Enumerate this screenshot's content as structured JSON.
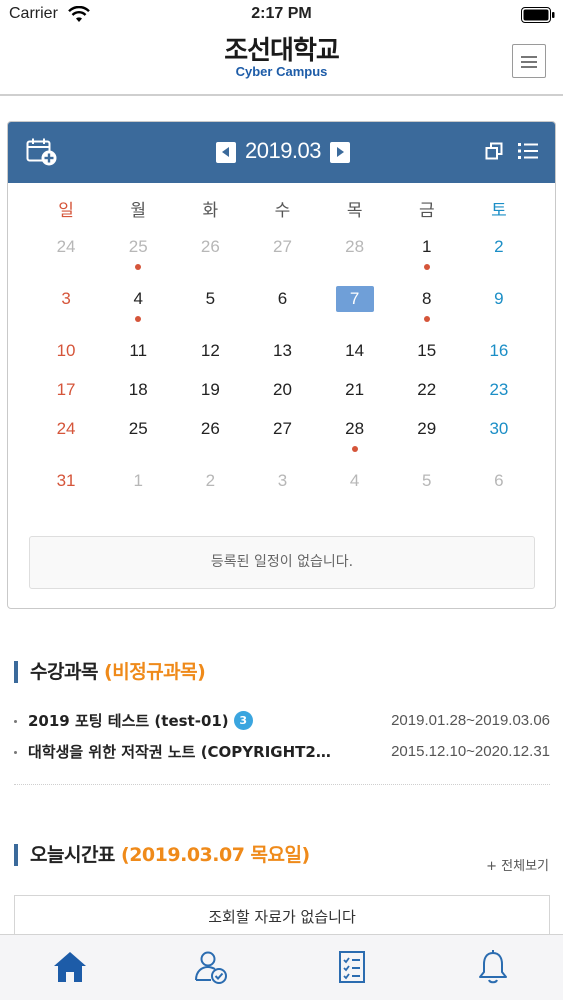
{
  "status_bar": {
    "carrier": "Carrier",
    "time": "2:17 PM"
  },
  "header": {
    "title": "조선대학교",
    "subtitle": "Cyber Campus",
    "menu_icon": "hamburger-menu-icon"
  },
  "calendar": {
    "month_label": "2019.03",
    "weekdays": [
      "일",
      "월",
      "화",
      "수",
      "목",
      "금",
      "토"
    ],
    "weeks": [
      [
        {
          "d": "24",
          "muted": true
        },
        {
          "d": "25",
          "muted": true,
          "dot": true
        },
        {
          "d": "26",
          "muted": true
        },
        {
          "d": "27",
          "muted": true
        },
        {
          "d": "28",
          "muted": true
        },
        {
          "d": "1",
          "dot": true
        },
        {
          "d": "2"
        }
      ],
      [
        {
          "d": "3"
        },
        {
          "d": "4",
          "dot": true
        },
        {
          "d": "5"
        },
        {
          "d": "6"
        },
        {
          "d": "7",
          "today": true
        },
        {
          "d": "8",
          "dot": true
        },
        {
          "d": "9"
        }
      ],
      [
        {
          "d": "10"
        },
        {
          "d": "11"
        },
        {
          "d": "12"
        },
        {
          "d": "13"
        },
        {
          "d": "14"
        },
        {
          "d": "15"
        },
        {
          "d": "16"
        }
      ],
      [
        {
          "d": "17"
        },
        {
          "d": "18"
        },
        {
          "d": "19"
        },
        {
          "d": "20"
        },
        {
          "d": "21"
        },
        {
          "d": "22"
        },
        {
          "d": "23"
        }
      ],
      [
        {
          "d": "24"
        },
        {
          "d": "25"
        },
        {
          "d": "26"
        },
        {
          "d": "27"
        },
        {
          "d": "28",
          "dot": true
        },
        {
          "d": "29"
        },
        {
          "d": "30"
        }
      ],
      [
        {
          "d": "31"
        },
        {
          "d": "1",
          "muted": true
        },
        {
          "d": "2",
          "muted": true
        },
        {
          "d": "3",
          "muted": true
        },
        {
          "d": "4",
          "muted": true
        },
        {
          "d": "5",
          "muted": true
        },
        {
          "d": "6",
          "muted": true
        }
      ]
    ],
    "no_events_text": "등록된 일정이 없습니다.",
    "colors": {
      "header_bg": "#3b6a9b",
      "sunday": "#d5553a",
      "saturday": "#1b8ec6",
      "today_bg": "#6f9fd8",
      "event_dot": "#d5553a"
    }
  },
  "courses": {
    "title": "수강과목",
    "title_accent": "(비정규과목)",
    "items": [
      {
        "name": "2019 포팅 테스트 (test-01)",
        "badge": "3",
        "period": "2019.01.28~2019.03.06"
      },
      {
        "name": "대학생을 위한 저작권 노트 (COPYRIGHT2…",
        "period": "2015.12.10~2020.12.31"
      }
    ]
  },
  "timetable": {
    "title": "오늘시간표",
    "title_accent": "(2019.03.07 목요일)",
    "view_all": "+ 전체보기",
    "empty_text": "조회할 자료가 없습니다"
  },
  "tab_bar": {
    "tabs": [
      {
        "icon": "home-icon",
        "active": true
      },
      {
        "icon": "user-check-icon"
      },
      {
        "icon": "checklist-icon"
      },
      {
        "icon": "bell-icon"
      }
    ],
    "active_color": "#1d5ca8",
    "inactive_color": "#2b6cb0"
  }
}
